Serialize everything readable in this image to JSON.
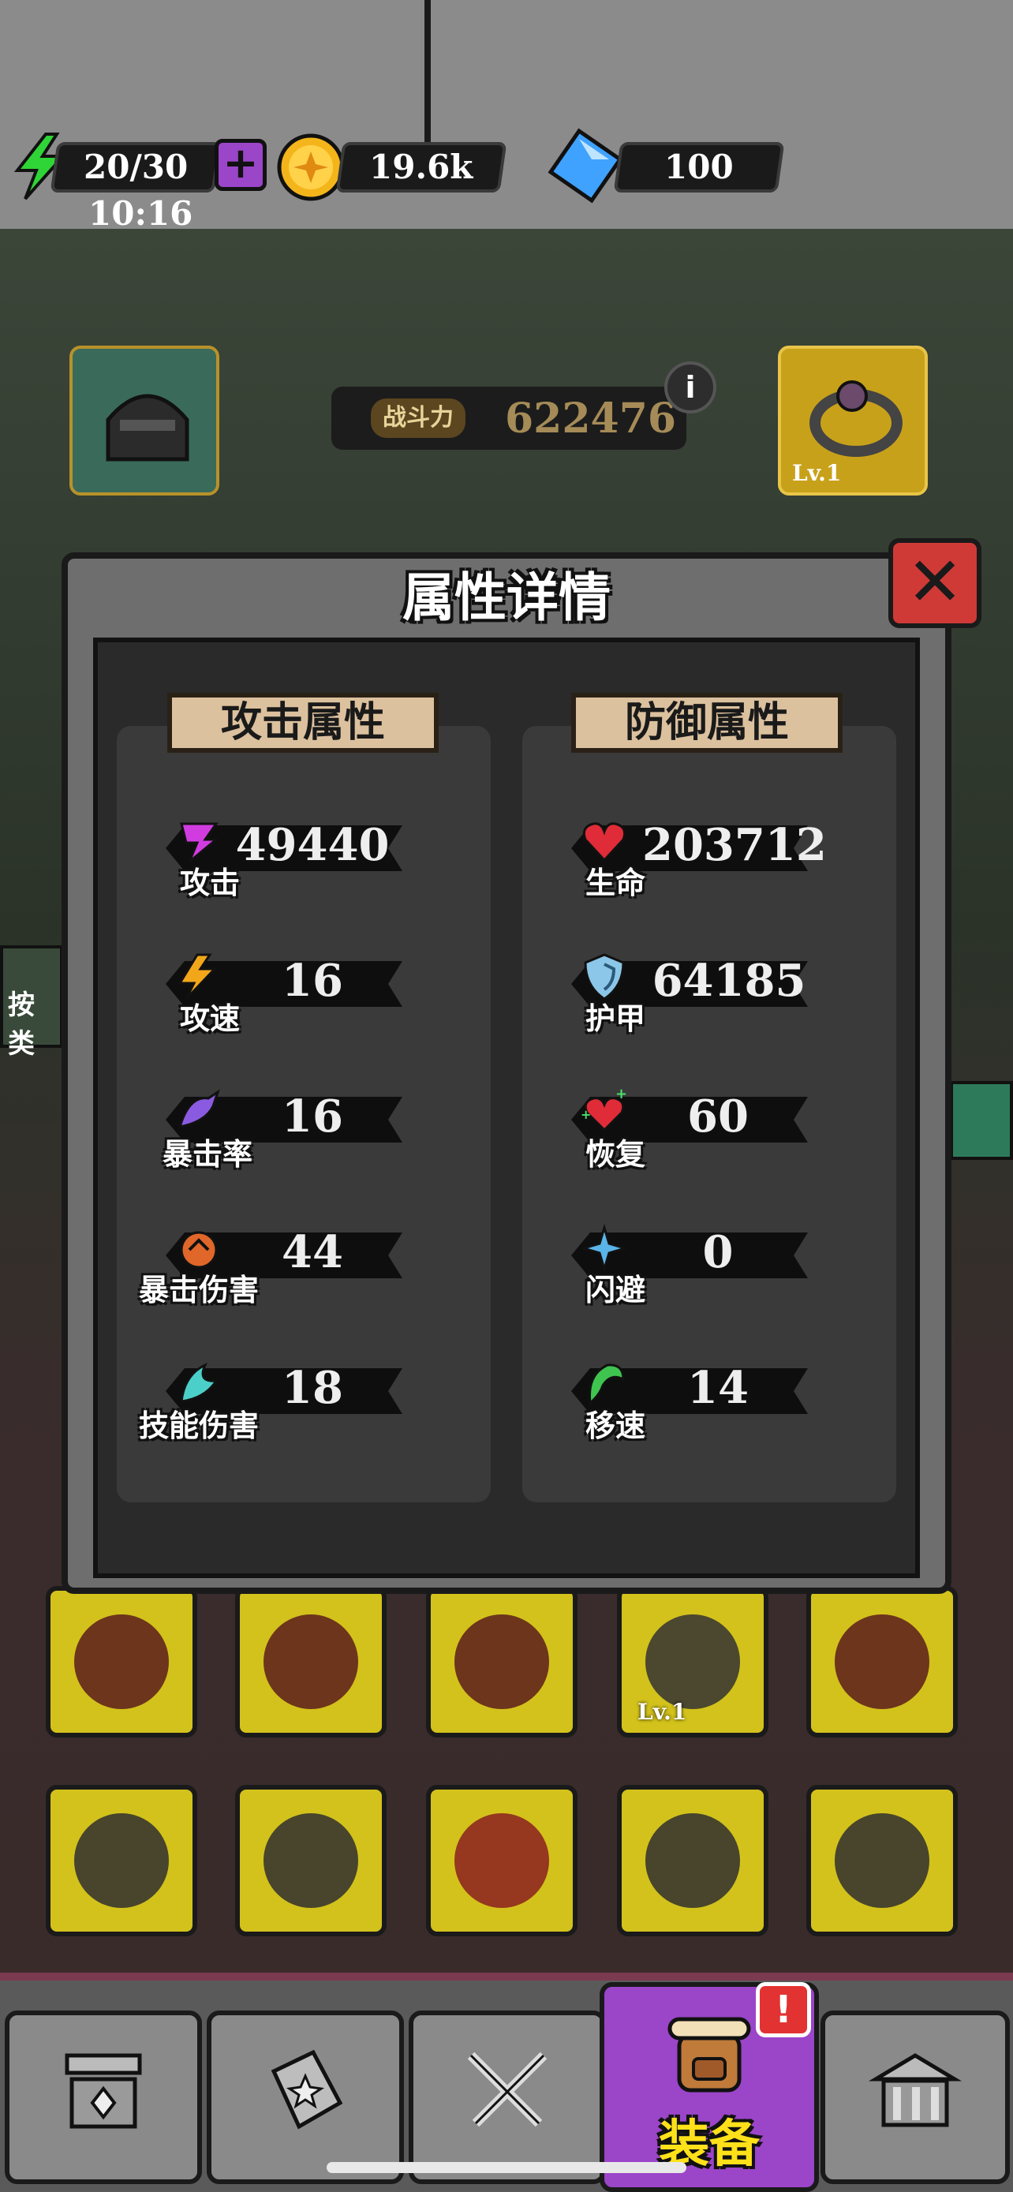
{
  "colors": {
    "accent_purple": "#9b45c9",
    "energy_green": "#2fd436",
    "coin_gold": "#f4b51b",
    "gem_blue": "#3fa2ff",
    "close_red": "#cf3a37",
    "nav_label": "#ffe11a"
  },
  "status_bar": {
    "energy": {
      "value": "20/30",
      "icon": "lightning-icon",
      "add_icon": "plus-icon"
    },
    "energy_timer": "10:16",
    "coins": {
      "value": "19.6k",
      "icon": "coin-icon"
    },
    "gems": {
      "value": "100",
      "icon": "diamond-icon"
    }
  },
  "combat_power": {
    "label": "战斗力",
    "value": "622476",
    "info_icon": "i"
  },
  "equip_slots_top": [
    {
      "icon": "helmet-icon",
      "level": ""
    },
    {
      "icon": "ring-icon",
      "level": "Lv.1"
    }
  ],
  "dialog": {
    "title": "属性详情",
    "close_icon": "close-icon",
    "attack": {
      "heading": "攻击属性",
      "stats": [
        {
          "label": "攻击",
          "value": "49440",
          "icon": "attack-icon"
        },
        {
          "label": "攻速",
          "value": "16",
          "icon": "attack-speed-icon"
        },
        {
          "label": "暴击率",
          "value": "16",
          "icon": "crit-rate-icon"
        },
        {
          "label": "暴击伤害",
          "value": "44",
          "icon": "crit-damage-icon"
        },
        {
          "label": "技能伤害",
          "value": "18",
          "icon": "skill-damage-icon"
        }
      ]
    },
    "defense": {
      "heading": "防御属性",
      "stats": [
        {
          "label": "生命",
          "value": "203712",
          "icon": "heart-icon"
        },
        {
          "label": "护甲",
          "value": "64185",
          "icon": "shield-icon"
        },
        {
          "label": "恢复",
          "value": "60",
          "icon": "regen-heart-icon"
        },
        {
          "label": "闪避",
          "value": "0",
          "icon": "dodge-icon"
        },
        {
          "label": "移速",
          "value": "14",
          "icon": "move-speed-icon"
        }
      ]
    }
  },
  "inventory_levels": [
    "",
    "",
    "",
    "Lv.1",
    ""
  ],
  "side_label": "按类",
  "bottom_nav": [
    {
      "icon": "signpost-icon",
      "label": ""
    },
    {
      "icon": "spellbook-icon",
      "label": ""
    },
    {
      "icon": "crossed-swords-icon",
      "label": ""
    },
    {
      "icon": "backpack-icon",
      "label": "装备",
      "badge": "!"
    },
    {
      "icon": "building-icon",
      "label": ""
    }
  ]
}
